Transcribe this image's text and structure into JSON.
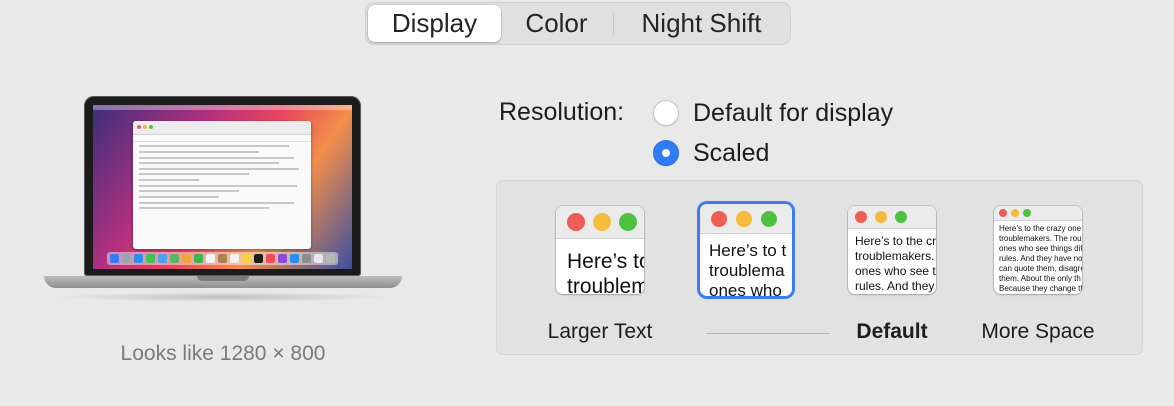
{
  "tabs": [
    {
      "label": "Display",
      "active": true
    },
    {
      "label": "Color",
      "active": false
    },
    {
      "label": "Night Shift",
      "active": false
    }
  ],
  "preview": {
    "looks_like": "Looks like 1280 × 800"
  },
  "resolution": {
    "label": "Resolution:",
    "options": [
      {
        "label": "Default for display",
        "selected": false
      },
      {
        "label": "Scaled",
        "selected": true
      }
    ]
  },
  "scaling": {
    "thumbnails": [
      {
        "lines": [
          "Here’s to",
          "troublem"
        ],
        "selected": false
      },
      {
        "lines": [
          "Here’s to t",
          "troublema",
          "ones who"
        ],
        "selected": true
      },
      {
        "lines": [
          "Here’s to the cr",
          "troublemakers.",
          "ones who see t",
          "rules. And they"
        ],
        "selected": false
      },
      {
        "lines": [
          "Here’s to the crazy one",
          "troublemakers. The rou",
          "ones who see things dif",
          "rules. And they have no",
          "can quote them, disagre",
          "them. About the only th",
          "Because they change th"
        ],
        "selected": false
      }
    ],
    "labels": {
      "larger": "Larger Text",
      "default": "Default",
      "more": "More Space"
    }
  },
  "colors": {
    "accent": "#2e7cf6",
    "traffic_red": "#ee5e55",
    "traffic_yellow": "#f4bc3a",
    "traffic_green": "#4ec140"
  }
}
